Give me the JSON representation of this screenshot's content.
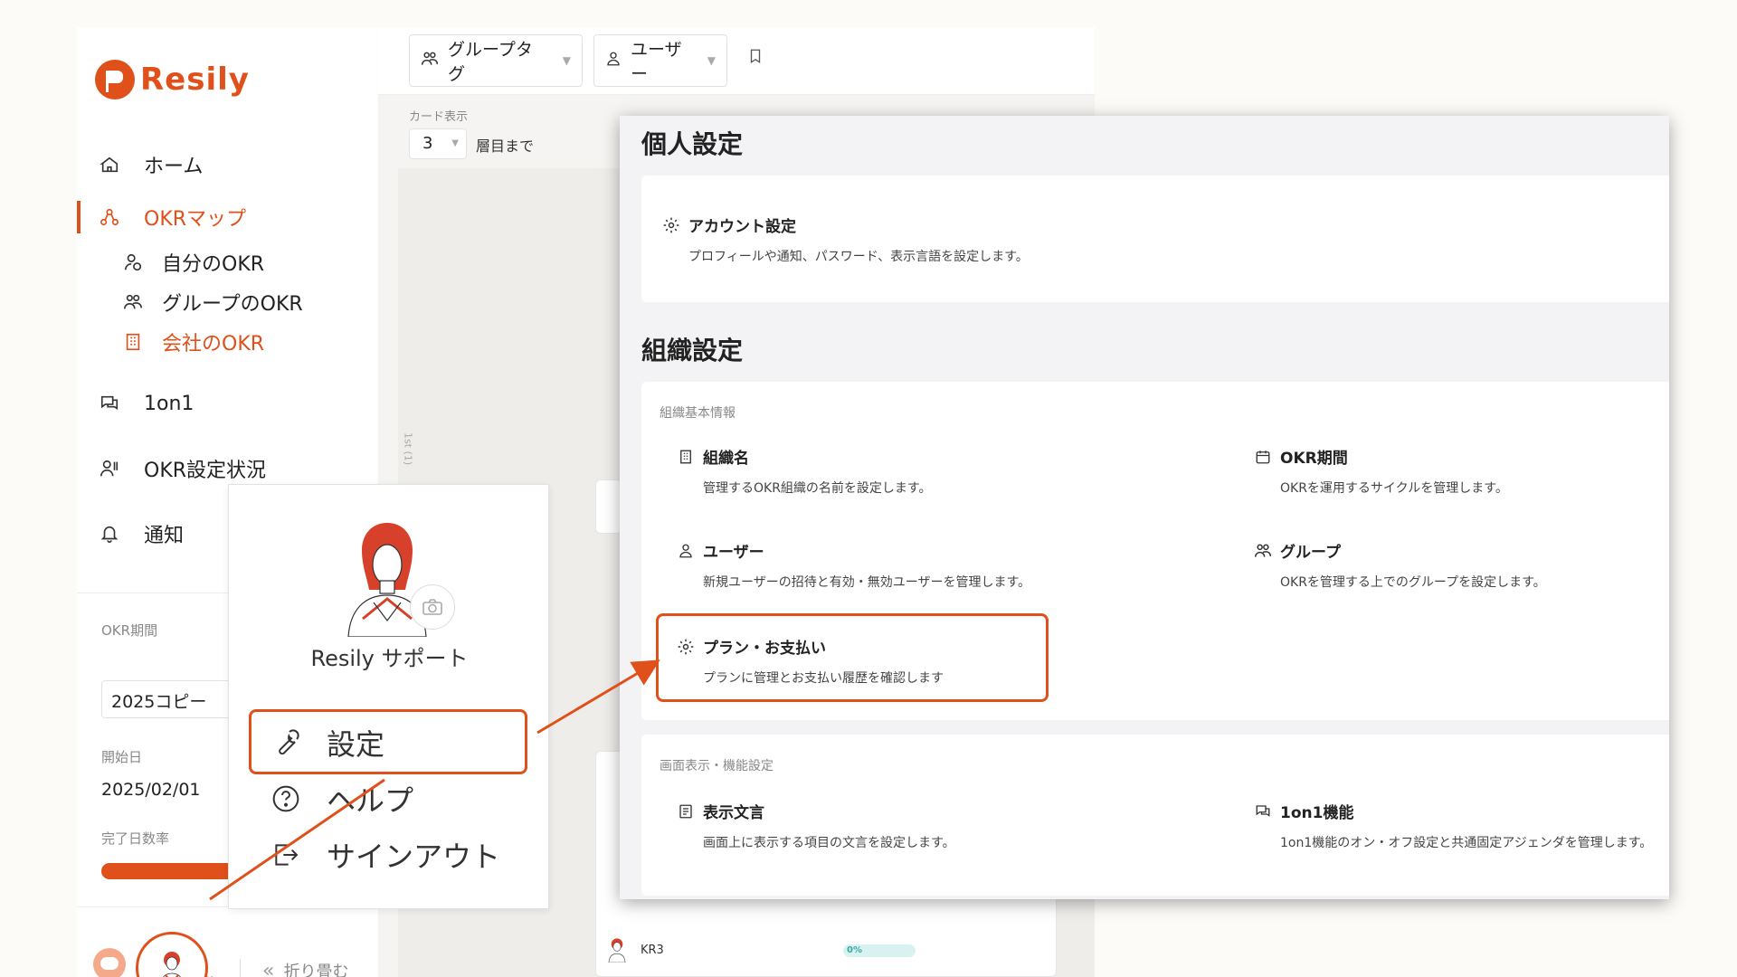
{
  "app": {
    "logo_text": "Resily"
  },
  "sidebar": {
    "items": [
      {
        "label": "ホーム",
        "icon": "home-icon"
      },
      {
        "label": "OKRマップ",
        "icon": "okr-map-icon",
        "active": true
      },
      {
        "label": "1on1",
        "icon": "chat-icon"
      },
      {
        "label": "OKR設定状況",
        "icon": "user-list-icon"
      },
      {
        "label": "通知",
        "icon": "bell-icon"
      }
    ],
    "sub_items": [
      {
        "label": "自分のOKR",
        "icon": "user-okr-icon"
      },
      {
        "label": "グループのOKR",
        "icon": "group-icon"
      },
      {
        "label": "会社のOKR",
        "icon": "building-icon",
        "active": true
      }
    ],
    "okr_period_label": "OKR期間",
    "okr_period_value": "2025コピー",
    "start_date_label": "開始日",
    "start_date_value": "2025/02/01",
    "completion_label": "完了日数率",
    "collapse_label": "折り畳む"
  },
  "toolbar": {
    "group_tag_label": "グループタグ",
    "user_label": "ユーザー",
    "card_display_label": "カード表示",
    "card_level_value": "3",
    "card_level_suffix": "層目まで",
    "level_tab": "1st (1)"
  },
  "canvas": {
    "kr_label": "KR3",
    "kr_progress": "0%"
  },
  "popup": {
    "name": "Resily サポート",
    "items": [
      {
        "label": "設定",
        "icon": "wrench-icon"
      },
      {
        "label": "ヘルプ",
        "icon": "help-icon"
      },
      {
        "label": "サインアウト",
        "icon": "signout-icon"
      }
    ]
  },
  "settings": {
    "personal_title": "個人設定",
    "account": {
      "title": "アカウント設定",
      "desc": "プロフィールや通知、パスワード、表示言語を設定します。"
    },
    "org_title": "組織設定",
    "org_basic_section": "組織基本情報",
    "org_name": {
      "title": "組織名",
      "desc": "管理するOKR組織の名前を設定します。"
    },
    "okr_period": {
      "title": "OKR期間",
      "desc": "OKRを運用するサイクルを管理します。"
    },
    "users": {
      "title": "ユーザー",
      "desc": "新規ユーザーの招待と有効・無効ユーザーを管理します。"
    },
    "groups": {
      "title": "グループ",
      "desc": "OKRを管理する上でのグループを設定します。"
    },
    "plan": {
      "title": "プラン・お支払い",
      "desc": "プランに管理とお支払い履歴を確認します"
    },
    "display_section": "画面表示・機能設定",
    "display_text": {
      "title": "表示文言",
      "desc": "画面上に表示する項目の文言を設定します。"
    },
    "oneonone": {
      "title": "1on1機能",
      "desc": "1on1機能のオン・オフ設定と共通固定アジェンダを管理します。"
    }
  },
  "colors": {
    "accent": "#e0501a",
    "progress_teal": "#3aa8a0"
  }
}
